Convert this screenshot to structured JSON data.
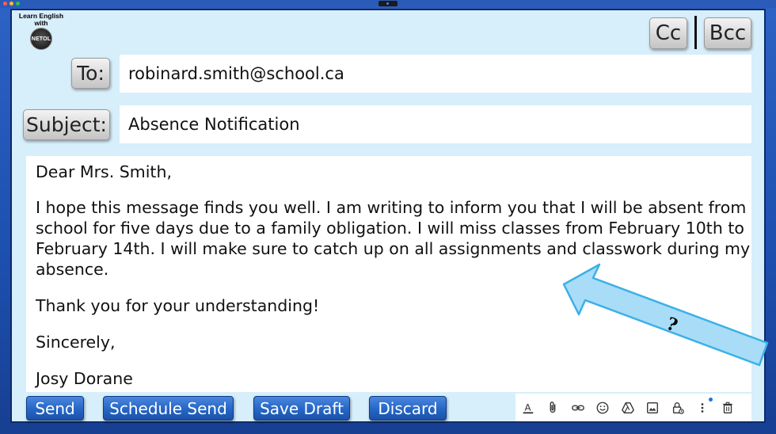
{
  "logo": {
    "line1": "Learn English",
    "line2": "with",
    "badge": "NETOL"
  },
  "header": {
    "cc_label": "Cc",
    "bcc_label": "Bcc"
  },
  "to": {
    "label": "To:",
    "value": "robinard.smith@school.ca"
  },
  "subject": {
    "label": "Subject:",
    "value": "Absence Notification"
  },
  "message": {
    "greeting": "Dear Mrs. Smith,",
    "paragraph1": "I hope this message finds you well. I am writing to inform you that I will be absent from school for five days due to a family obligation. I will miss classes from February 10th to February 14th. I will make sure to catch up on all assignments and classwork during my absence.",
    "thanks": "Thank you for your understanding!",
    "closing": "Sincerely,",
    "signature": "Josy Dorane"
  },
  "actions": {
    "send": "Send",
    "schedule_send": "Schedule Send",
    "save_draft": "Save Draft",
    "discard": "Discard"
  },
  "toolbar_icons": [
    "format-text-icon",
    "attach-icon",
    "link-icon",
    "emoji-icon",
    "drive-icon",
    "image-icon",
    "confidential-lock-icon",
    "more-options-icon",
    "trash-icon"
  ],
  "annotation": {
    "mark": "?"
  },
  "colors": {
    "screen_bg": "#d7eefb",
    "button_blue": "#2566c6",
    "arrow_fill": "#a8dcf7",
    "arrow_stroke": "#3bb0e8"
  }
}
